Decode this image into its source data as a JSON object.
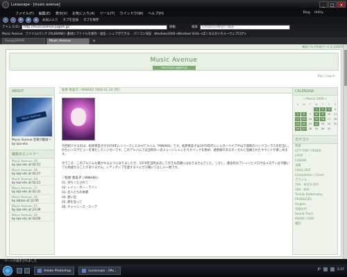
{
  "window": {
    "title": "Lunascape - [music avenue]",
    "controls": [
      "_",
      "□",
      "×"
    ]
  },
  "menu": [
    "ファイル(F)",
    "編集(E)",
    "表示(V)",
    "お気に入り(A)",
    "ツール(T)",
    "ウインドウ(W)",
    "ヘルプ(H)"
  ],
  "right_tools": [
    "Blog",
    "Utility"
  ],
  "toolbar": [
    "お気に入り",
    "タブを追加",
    "タブを保存"
  ],
  "address": {
    "label": "アドレス(D)",
    "url": "http://musicavenue.jugem.jp/",
    "go": "移動",
    "search_label": "検索",
    "search_placeholder": "Google(日本語)で検索"
  },
  "links": [
    "Music Avenue",
    "ファイル/パンク [FILEBANK] -素材にファイルを保存・送信・シェアができる-",
    "パソコン日記",
    "Windows2000→Windows Vista <ぼくなるかいちゃ~ウェブログ>"
  ],
  "tabs": [
    {
      "label": "Googl/JAPAN",
      "active": false
    },
    {
      "label": "Music Avenue",
      "active": true
    }
  ],
  "page": {
    "top_right": "無料ブログ作成サービス JUGEM",
    "site_title": "Music Avenue",
    "site_url": "musicave.jugem.jp",
    "toplinks": "Top | Log-in",
    "about": {
      "heading": "ABOUT",
      "image_sign": "Music Avenue",
      "text": "Music Avenue 音楽が最高～ by kaz-ehs"
    },
    "recent": {
      "heading": "最新のエントリー",
      "items": [
        {
          "title": "Music Avenue: 30",
          "meta": "by kaz-ehs at 02:51"
        },
        {
          "title": "Music Avenue: 29",
          "meta": "by kaz-ehs at 02:27"
        },
        {
          "title": "Music Avenue: 28",
          "meta": "by kaz-ehs at 02:21"
        },
        {
          "title": "Music Avenue: 27",
          "meta": "by kaz-ehs at 02:31"
        },
        {
          "title": "Music Avenue: 26",
          "meta": "by kotaro at 12:00"
        },
        {
          "title": "Music Avenue: 25",
          "meta": "by kaz-ehs at 23:39"
        },
        {
          "title": "Music Avenue: 24",
          "meta": "by kaz-ehs at 03:00"
        }
      ]
    },
    "entry": {
      "header": "松原 恵美子 / MINAKO 2006.01.30 [月]",
      "paragraphs": [
        "今回紹介するのは、松原恵美子が1979年にリリースした2ndアルバム『MINAKO』です。松原恵美子は1970年代にシュガーベイブや山下達郎のバックコーラスを担当し、のちにソロデビューを果たしたシンガーです。このアルバムでは当時の一流ミュージシャンたちがバックを務め、透明感のあるボーカルと洗練されたサウンドが楽しめます。",
        "今でこそ、このアルバムも聴かれるようになりましたが、1979年当時は決して大きな話題にはなりませんでした。しかし、都会的なアレンジとメロウなメロディは今聴いても色褪せることがありません。シティポップを愛する人にぜひ聴いてほしい一枚です。"
      ],
      "track_title": "『松原 恵美子 / MINAKO』",
      "tracks": [
        "01. 待ちくたびれて",
        "02. レイン・ボー・ライン",
        "03. 恋人たちの季節",
        "04. 想い出",
        "05. 夢を追って",
        "06. チャイニーズ・スープ"
      ]
    },
    "calendar": {
      "heading": "CALENDAR",
      "month": "« March 2006 »",
      "days_header": [
        "S",
        "M",
        "T",
        "W",
        "T",
        "F",
        "S"
      ],
      "days": [
        "",
        "",
        "",
        "1",
        "2",
        "3",
        "4",
        "5",
        "6",
        "7",
        "8",
        "9",
        "10",
        "11",
        "12",
        "13",
        "14",
        "15",
        "16",
        "17",
        "18",
        "19",
        "20",
        "21",
        "22",
        "23",
        "24",
        "25",
        "26",
        "27",
        "28",
        "29",
        "30",
        "31",
        ""
      ],
      "filled_days": [
        "1",
        "2",
        "3",
        "5",
        "6",
        "8",
        "9",
        "12",
        "13",
        "15",
        "16",
        "19",
        "20",
        "22",
        "26",
        "27"
      ]
    },
    "categories": {
      "heading": "カテゴリ",
      "items": [
        "邦楽",
        "CITY POP / FADER",
        "J-POP",
        "FUSION",
        "洋楽",
        "CHILL OUT",
        "Compilation / Cover",
        "ブラジル",
        "70S - ROCK OFF",
        "180 - 60S",
        "Toshiki Kadomatsu",
        "PRODUCER",
        "Singles",
        "企画もの",
        "Sound Track",
        "MOVIE / DVD",
        "雑記"
      ]
    }
  },
  "status": "ページが表示されました",
  "taskbar": {
    "tasks": [
      "Adobe Photoshop",
      "Lunascape - [Mu..."
    ],
    "lang": "JP",
    "clock": "2:47"
  }
}
